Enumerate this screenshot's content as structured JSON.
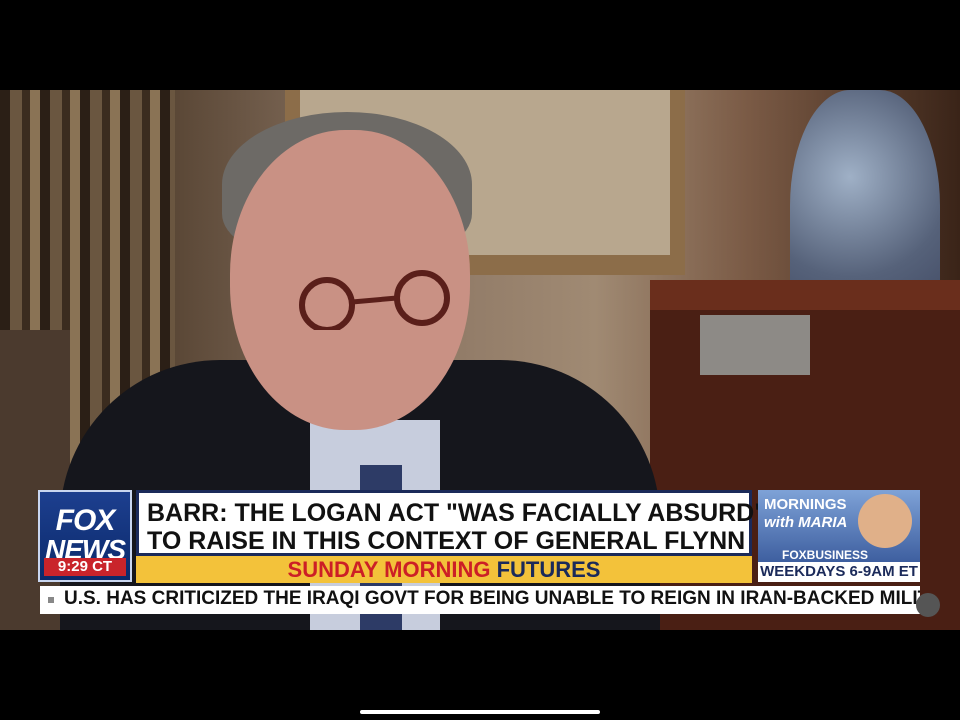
{
  "broadcast": {
    "logo_line1": "FOX",
    "logo_line2": "NEWS",
    "time": "9:29 CT",
    "headline_line1": "BARR: THE LOGAN ACT \"WAS FACIALLY ABSURD\"",
    "headline_line2": "TO RAISE IN THIS CONTEXT OF GENERAL FLYNN",
    "show_name_part1": "SUNDAY MORNING",
    "show_name_part2": "FUTURES",
    "ticker_text": "U.S. HAS CRITICIZED THE IRAQI GOVT FOR BEING UNABLE TO REIGN IN IRAN-BACKED MILITIA GROUPS I"
  },
  "promo": {
    "title": "MORNINGS",
    "subtitle": "with MARIA",
    "network": "FOXBUSINESS",
    "schedule": "WEEKDAYS 6-9AM ET"
  },
  "colors": {
    "fox_blue": "#0b2a6b",
    "accent_red": "#c9242b",
    "show_yellow": "#f3c23a"
  }
}
